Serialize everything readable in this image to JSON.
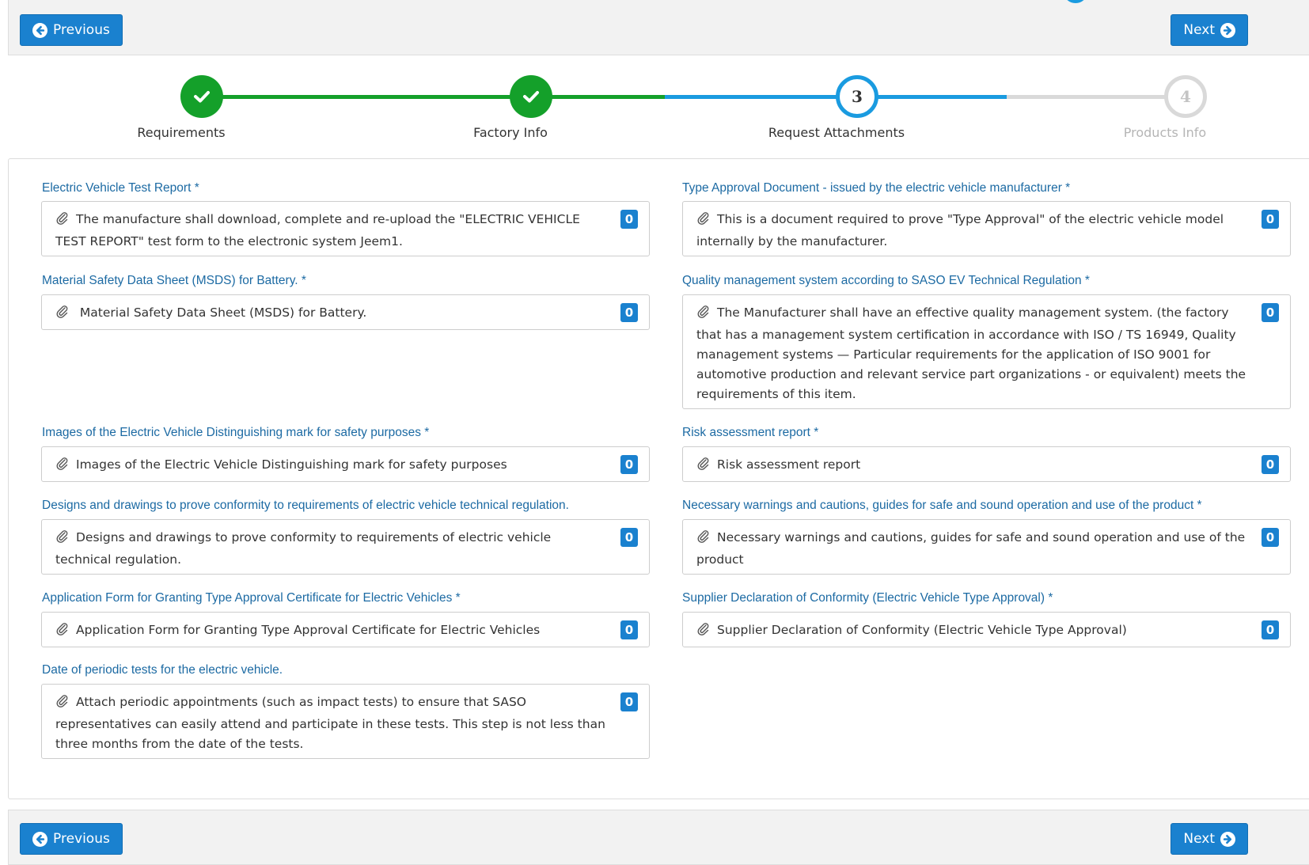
{
  "nav": {
    "previous_label": "Previous",
    "next_label": "Next"
  },
  "steps": [
    {
      "number": "1",
      "label": "Requirements",
      "status": "completed"
    },
    {
      "number": "2",
      "label": "Factory Info",
      "status": "completed"
    },
    {
      "number": "3",
      "label": "Request Attachments",
      "status": "current"
    },
    {
      "number": "4",
      "label": "Products Info",
      "status": "disabled"
    }
  ],
  "attachments": [
    {
      "label": "Electric Vehicle Test Report *",
      "description": "The manufacture shall download, complete and re-upload the \"ELECTRIC VEHICLE TEST REPORT\" test form to the electronic system Jeem1.",
      "count": "0"
    },
    {
      "label": "Type Approval Document - issued by the electric vehicle manufacturer *",
      "description": "This is a document required to prove \"Type Approval\" of the electric vehicle model internally by the manufacturer.",
      "count": "0"
    },
    {
      "label": "Material Safety Data Sheet (MSDS) for Battery. *",
      "description": " Material Safety Data Sheet (MSDS) for Battery.",
      "count": "0"
    },
    {
      "label": "Quality management system according to SASO EV Technical Regulation *",
      "description": "The Manufacturer shall have an effective quality management system. (the factory that has a management system certification in accordance with ISO / TS 16949, Quality management systems — Particular requirements for the application of ISO 9001 for automotive production and relevant service part organizations - or equivalent) meets the requirements of this item.",
      "count": "0"
    },
    {
      "label": "Images of the Electric Vehicle Distinguishing mark for safety purposes *",
      "description": "Images of the Electric Vehicle Distinguishing mark for safety purposes",
      "count": "0"
    },
    {
      "label": "Risk assessment report *",
      "description": "Risk assessment report",
      "count": "0"
    },
    {
      "label": "Designs and drawings to prove conformity to requirements of electric vehicle technical regulation.",
      "description": "Designs and drawings to prove conformity to requirements of electric vehicle technical regulation.",
      "count": "0"
    },
    {
      "label": "Necessary warnings and cautions, guides for safe and sound operation and use of the product *",
      "description": "Necessary warnings and cautions, guides for safe and sound operation and use of the product",
      "count": "0"
    },
    {
      "label": "Application Form for Granting Type Approval Certificate for Electric Vehicles *",
      "description": "Application Form for Granting Type Approval Certificate for Electric Vehicles",
      "count": "0"
    },
    {
      "label": "Supplier Declaration of Conformity (Electric Vehicle Type Approval) *",
      "description": "Supplier Declaration of Conformity (Electric Vehicle Type Approval)",
      "count": "0"
    },
    {
      "label": "Date of periodic tests for the electric vehicle.",
      "description": "Attach periodic appointments (such as impact tests) to ensure that SASO representatives can easily attend and participate in these tests. This step is not less than three months from the date of the tests.",
      "count": "0"
    }
  ],
  "colors": {
    "primary": "#1a81cf",
    "completed": "#14a02a",
    "current": "#1a9be0",
    "disabled": "#d9d9d9",
    "label_blue": "#1c6aa3"
  },
  "icons": {
    "previous": "arrow-left-circle-icon",
    "next": "arrow-right-circle-icon",
    "completed_step": "check-icon",
    "attachment": "paperclip-icon"
  }
}
